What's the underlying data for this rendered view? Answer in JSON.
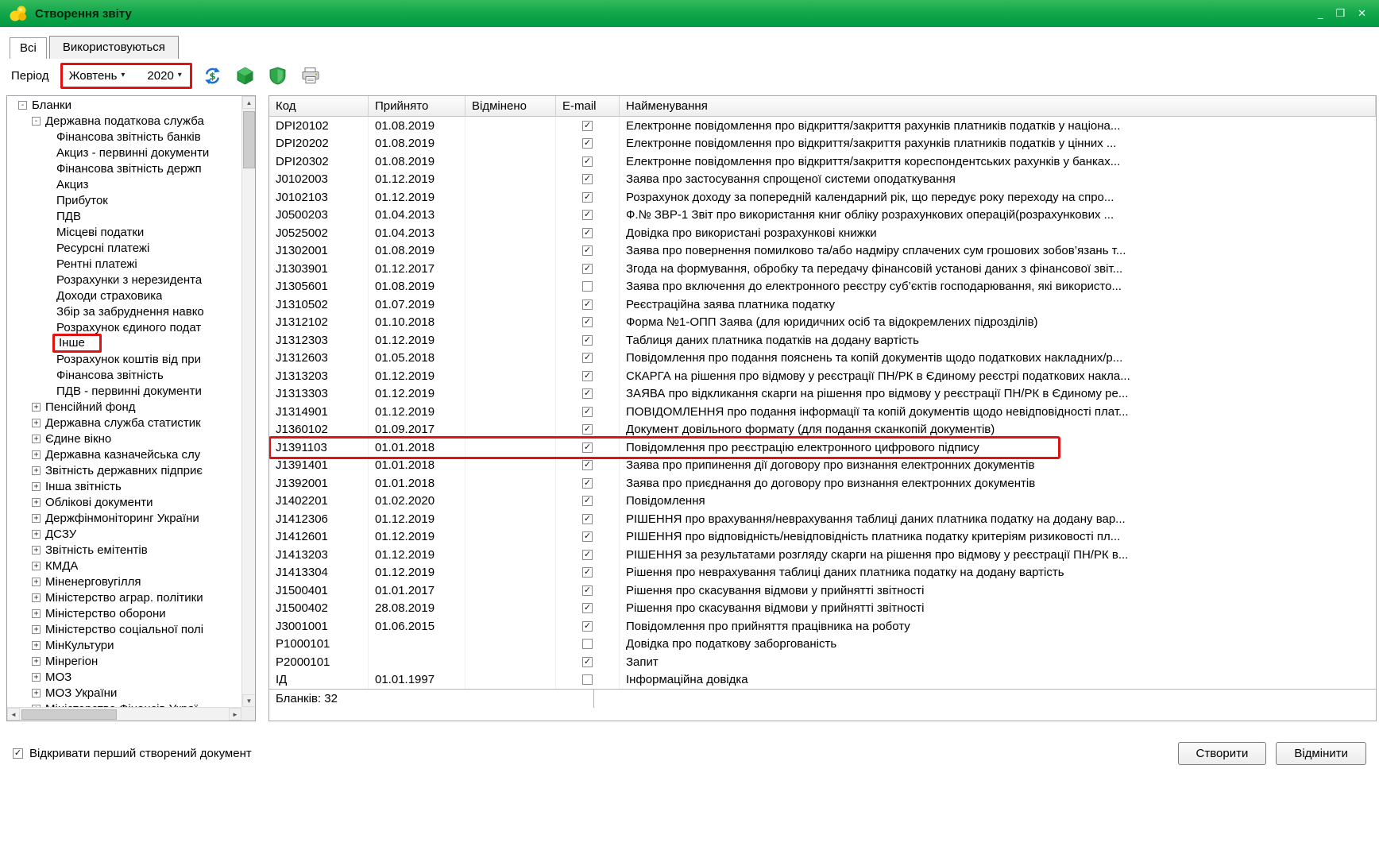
{
  "colors": {
    "titlebar_green": "#0aa449",
    "annotation_red": "#e01212"
  },
  "window": {
    "title": "Створення звіту"
  },
  "window_controls": [
    {
      "name": "minimize-button"
    },
    {
      "name": "maximize-button"
    },
    {
      "name": "close-button"
    }
  ],
  "tabs": [
    {
      "name": "tab-all",
      "label": "Всі",
      "active": false
    },
    {
      "name": "tab-used",
      "label": "Використовуються",
      "active": true
    }
  ],
  "toolbar": {
    "period_label": "Період",
    "month": "Жовтень",
    "year": "2020",
    "icons": [
      {
        "name": "exchange-rates-icon"
      },
      {
        "name": "green-package-icon"
      },
      {
        "name": "shield-icon"
      },
      {
        "name": "printer-icon"
      }
    ]
  },
  "tree": {
    "items": [
      {
        "label": "Бланки",
        "level": 0,
        "toggle": "minus"
      },
      {
        "label": "Державна податкова служба",
        "level": 1,
        "toggle": "minus"
      },
      {
        "label": "Фінансова звітність банків",
        "level": 2,
        "toggle": "none"
      },
      {
        "label": "Акциз - первинні документи",
        "level": 2,
        "toggle": "none"
      },
      {
        "label": "Фінансова звітність держп",
        "level": 2,
        "toggle": "none"
      },
      {
        "label": "Акциз",
        "level": 2,
        "toggle": "none"
      },
      {
        "label": "Прибуток",
        "level": 2,
        "toggle": "none"
      },
      {
        "label": "ПДВ",
        "level": 2,
        "toggle": "none"
      },
      {
        "label": "Місцеві податки",
        "level": 2,
        "toggle": "none"
      },
      {
        "label": "Ресурсні платежі",
        "level": 2,
        "toggle": "none"
      },
      {
        "label": "Рентні платежі",
        "level": 2,
        "toggle": "none"
      },
      {
        "label": "Розрахунки з нерезидента",
        "level": 2,
        "toggle": "none"
      },
      {
        "label": "Доходи страховика",
        "level": 2,
        "toggle": "none"
      },
      {
        "label": "Збір за забруднення навко",
        "level": 2,
        "toggle": "none"
      },
      {
        "label": "Розрахунок єдиного подат",
        "level": 2,
        "toggle": "none"
      },
      {
        "label": "Інше",
        "level": 2,
        "toggle": "none",
        "highlight": true
      },
      {
        "label": "Розрахунок коштів від при",
        "level": 2,
        "toggle": "none"
      },
      {
        "label": "Фінансова звітність",
        "level": 2,
        "toggle": "none"
      },
      {
        "label": "ПДВ - первинні документи",
        "level": 2,
        "toggle": "none"
      },
      {
        "label": "Пенсійний фонд",
        "level": 1,
        "toggle": "plus"
      },
      {
        "label": "Державна служба статистик",
        "level": 1,
        "toggle": "plus"
      },
      {
        "label": "Єдине вікно",
        "level": 1,
        "toggle": "plus"
      },
      {
        "label": "Державна казначейська слу",
        "level": 1,
        "toggle": "plus"
      },
      {
        "label": "Звітність державних підприє",
        "level": 1,
        "toggle": "plus"
      },
      {
        "label": "Інша звітність",
        "level": 1,
        "toggle": "plus"
      },
      {
        "label": "Облікові документи",
        "level": 1,
        "toggle": "plus"
      },
      {
        "label": "Держфінмоніторинг України",
        "level": 1,
        "toggle": "plus"
      },
      {
        "label": "ДСЗУ",
        "level": 1,
        "toggle": "plus"
      },
      {
        "label": "Звітність емітентів",
        "level": 1,
        "toggle": "plus"
      },
      {
        "label": "КМДА",
        "level": 1,
        "toggle": "plus"
      },
      {
        "label": "Міненерговугілля",
        "level": 1,
        "toggle": "plus"
      },
      {
        "label": "Міністерство аграр. політики",
        "level": 1,
        "toggle": "plus"
      },
      {
        "label": "Міністерство оборони",
        "level": 1,
        "toggle": "plus"
      },
      {
        "label": "Міністерство соціальної полі",
        "level": 1,
        "toggle": "plus"
      },
      {
        "label": "МінКультури",
        "level": 1,
        "toggle": "plus"
      },
      {
        "label": "Мінрегіон",
        "level": 1,
        "toggle": "plus"
      },
      {
        "label": "МОЗ",
        "level": 1,
        "toggle": "plus"
      },
      {
        "label": "МОЗ України",
        "level": 1,
        "toggle": "plus"
      },
      {
        "label": "Міністерство Фінансів Украї",
        "level": 1,
        "toggle": "plus"
      }
    ]
  },
  "table": {
    "columns": [
      "Код",
      "Прийнято",
      "Відмінено",
      "E-mail",
      "Найменування"
    ],
    "footer": "Бланків: 32",
    "rows": [
      {
        "code": "DPI20102",
        "accepted": "01.08.2019",
        "cancelled": "",
        "email": true,
        "name": "Електронне повідомлення про відкриття/закриття рахунків платників податків у націона..."
      },
      {
        "code": "DPI20202",
        "accepted": "01.08.2019",
        "cancelled": "",
        "email": true,
        "name": "Електронне повідомлення про відкриття/закриття рахунків платників податків у цінних ..."
      },
      {
        "code": "DPI20302",
        "accepted": "01.08.2019",
        "cancelled": "",
        "email": true,
        "name": "Електронне повідомлення про відкриття/закриття кореспондентських рахунків у банках..."
      },
      {
        "code": "J0102003",
        "accepted": "01.12.2019",
        "cancelled": "",
        "email": true,
        "name": "Заява про застосування спрощеної системи оподаткування"
      },
      {
        "code": "J0102103",
        "accepted": "01.12.2019",
        "cancelled": "",
        "email": true,
        "name": "Розрахунок доходу за попередній календарний рік, що передує року переходу на спро..."
      },
      {
        "code": "J0500203",
        "accepted": "01.04.2013",
        "cancelled": "",
        "email": true,
        "name": "Ф.№ ЗВР-1 Звіт про використання книг обліку розрахункових операцій(розрахункових ..."
      },
      {
        "code": "J0525002",
        "accepted": "01.04.2013",
        "cancelled": "",
        "email": true,
        "name": "Довідка про використані розрахункові книжки"
      },
      {
        "code": "J1302001",
        "accepted": "01.08.2019",
        "cancelled": "",
        "email": true,
        "name": "Заява про повернення помилково та/або надміру сплачених сум грошових зобов’язань т..."
      },
      {
        "code": "J1303901",
        "accepted": "01.12.2017",
        "cancelled": "",
        "email": true,
        "name": "Згода на формування, обробку та передачу фінансовій установі даних з фінансової звіт..."
      },
      {
        "code": "J1305601",
        "accepted": "01.08.2019",
        "cancelled": "",
        "email": false,
        "name": "Заява про включення до електронного реєстру суб’єктів господарювання, які використо..."
      },
      {
        "code": "J1310502",
        "accepted": "01.07.2019",
        "cancelled": "",
        "email": true,
        "name": "Реєстраційна заява платника податку"
      },
      {
        "code": "J1312102",
        "accepted": "01.10.2018",
        "cancelled": "",
        "email": true,
        "name": "Форма №1-ОПП Заява (для юридичних осіб та відокремлених підрозділів)"
      },
      {
        "code": "J1312303",
        "accepted": "01.12.2019",
        "cancelled": "",
        "email": true,
        "name": "Таблиця даних платника податків на додану вартість"
      },
      {
        "code": "J1312603",
        "accepted": "01.05.2018",
        "cancelled": "",
        "email": true,
        "name": "Повідомлення про подання пояснень та копій документів щодо податкових накладних/р..."
      },
      {
        "code": "J1313203",
        "accepted": "01.12.2019",
        "cancelled": "",
        "email": true,
        "name": "СКАРГА на рішення про відмову у реєстрації ПН/РК в Єдиному реєстрі податкових накла..."
      },
      {
        "code": "J1313303",
        "accepted": "01.12.2019",
        "cancelled": "",
        "email": true,
        "name": "ЗАЯВА про відкликання скарги на рішення про відмову у реєстрації ПН/РК в Єдиному ре..."
      },
      {
        "code": "J1314901",
        "accepted": "01.12.2019",
        "cancelled": "",
        "email": true,
        "name": "ПОВІДОМЛЕННЯ про подання інформації та копій документів щодо невідповідності плат..."
      },
      {
        "code": "J1360102",
        "accepted": "01.09.2017",
        "cancelled": "",
        "email": true,
        "name": "Документ довільного формату (для подання сканкопій документів)"
      },
      {
        "code": "J1391103",
        "accepted": "01.01.2018",
        "cancelled": "",
        "email": true,
        "name": "Повідомлення про реєстрацію електронного цифрового підпису",
        "highlight": true
      },
      {
        "code": "J1391401",
        "accepted": "01.01.2018",
        "cancelled": "",
        "email": true,
        "name": "Заява про припинення дії договору про визнання електронних документів"
      },
      {
        "code": "J1392001",
        "accepted": "01.01.2018",
        "cancelled": "",
        "email": true,
        "name": "Заява про приєднання до договору про визнання електронних документів"
      },
      {
        "code": "J1402201",
        "accepted": "01.02.2020",
        "cancelled": "",
        "email": true,
        "name": "Повідомлення"
      },
      {
        "code": "J1412306",
        "accepted": "01.12.2019",
        "cancelled": "",
        "email": true,
        "name": "РІШЕННЯ про врахування/неврахування таблиці даних платника податку на додану вар..."
      },
      {
        "code": "J1412601",
        "accepted": "01.12.2019",
        "cancelled": "",
        "email": true,
        "name": "РІШЕННЯ про відповідність/невідповідність платника податку критеріям ризиковості пл..."
      },
      {
        "code": "J1413203",
        "accepted": "01.12.2019",
        "cancelled": "",
        "email": true,
        "name": "РІШЕННЯ за результатами розгляду скарги на рішення про відмову у реєстрації ПН/РК в..."
      },
      {
        "code": "J1413304",
        "accepted": "01.12.2019",
        "cancelled": "",
        "email": true,
        "name": "Рішення про неврахування таблиці даних платника податку на додану вартість"
      },
      {
        "code": "J1500401",
        "accepted": "01.01.2017",
        "cancelled": "",
        "email": true,
        "name": "Рішення про скасування відмови у прийнятті звітності"
      },
      {
        "code": "J1500402",
        "accepted": "28.08.2019",
        "cancelled": "",
        "email": true,
        "name": "Рішення про скасування відмови у прийнятті звітності"
      },
      {
        "code": "J3001001",
        "accepted": "01.06.2015",
        "cancelled": "",
        "email": true,
        "name": "Повідомлення про прийняття працівника на роботу"
      },
      {
        "code": "P1000101",
        "accepted": "",
        "cancelled": "",
        "email": false,
        "name": "Довідка про податкову заборгованість"
      },
      {
        "code": "P2000101",
        "accepted": "",
        "cancelled": "",
        "email": true,
        "name": "Запит"
      },
      {
        "code": "ІД",
        "accepted": "01.01.1997",
        "cancelled": "",
        "email": false,
        "name": "Інформаційна довідка"
      }
    ]
  },
  "footer": {
    "checkbox_label": "Відкривати перший створений документ",
    "checkbox_checked": true,
    "create_button": "Створити",
    "cancel_button": "Відмінити"
  }
}
